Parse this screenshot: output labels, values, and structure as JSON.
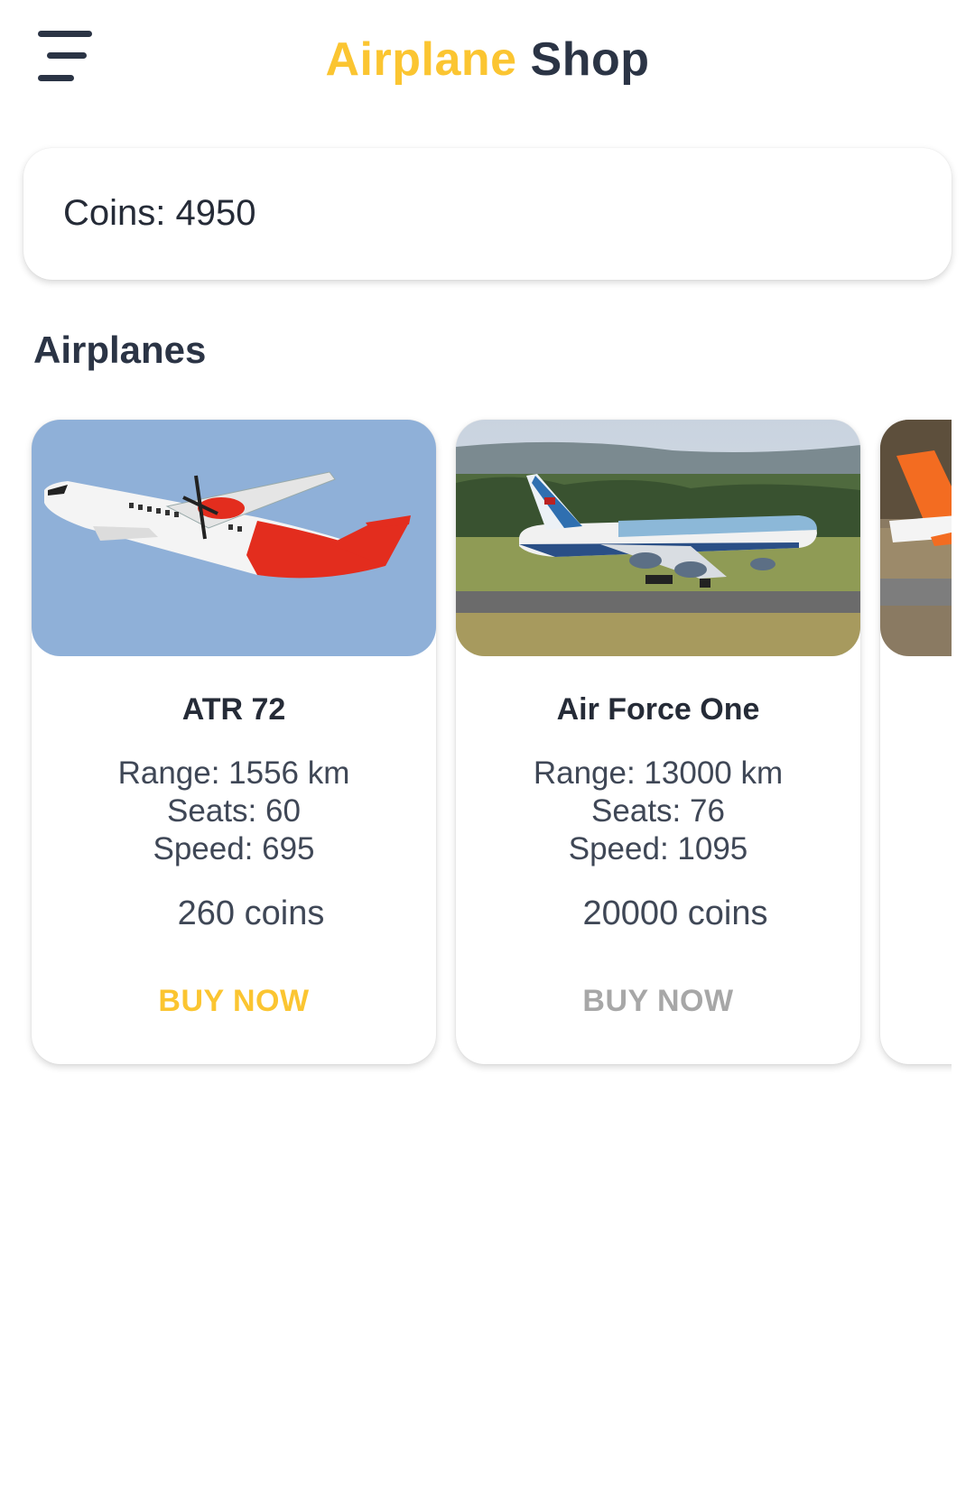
{
  "header": {
    "title_accent": "Airplane",
    "title_main": "Shop",
    "menu_icon": "hamburger-menu-icon"
  },
  "wallet": {
    "coins_label": "Coins: 4950"
  },
  "section": {
    "title": "Airplanes"
  },
  "airplanes": [
    {
      "name": "ATR 72",
      "range": "Range: 1556 km",
      "seats": "Seats: 60",
      "speed": "Speed: 695",
      "price": "260 coins",
      "buy_label": "BUY NOW",
      "image": "atr-72-firefly-photo",
      "affordable": true
    },
    {
      "name": "Air Force One",
      "range": "Range: 13000 km",
      "seats": "Seats: 76",
      "speed": "Speed: 1095",
      "price": "20000 coins",
      "buy_label": "BUY NOW",
      "image": "air-force-one-photo",
      "affordable": false
    },
    {
      "image": "easyjet-tail-photo"
    }
  ],
  "colors": {
    "accent": "#fbc531",
    "text_dark": "#2b3445",
    "disabled": "#a7a7a7"
  }
}
